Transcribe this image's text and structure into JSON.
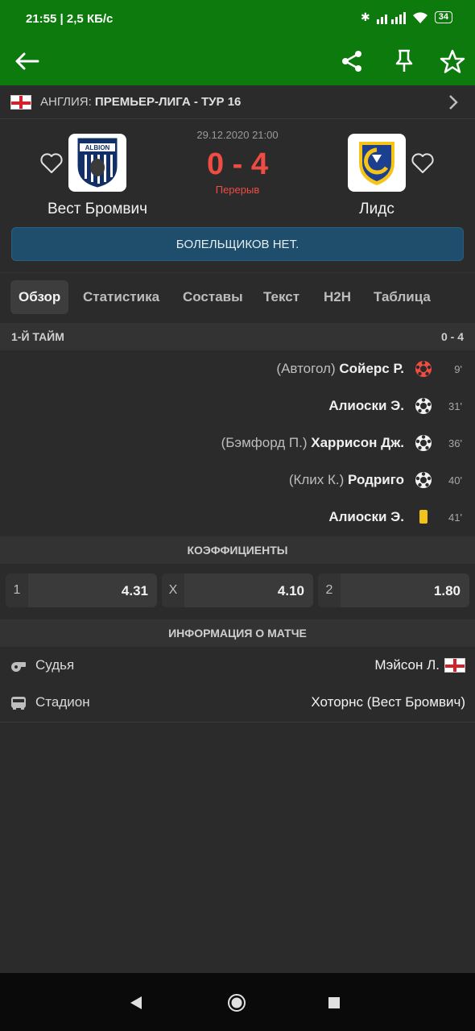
{
  "status_bar": {
    "time": "21:55",
    "speed": "2,5 КБ/с",
    "battery": "34"
  },
  "toolbar": {
    "back_icon": "arrow-left-icon",
    "share_icon": "share-icon",
    "pin_icon": "pin-icon",
    "favorite_icon": "star-icon"
  },
  "league": {
    "country": "АНГЛИЯ:",
    "name": "ПРЕМЬЕР-ЛИГА - ТУР 16"
  },
  "match": {
    "datetime": "29.12.2020 21:00",
    "score": "0 - 4",
    "status": "Перерыв",
    "home_team": "Вест Бромвич",
    "away_team": "Лидс",
    "home_logo_text": "ALBION",
    "fans_banner": "БОЛЕЛЬЩИКОВ НЕТ."
  },
  "tabs": [
    "Обзор",
    "Статистика",
    "Составы",
    "Текст",
    "H2H",
    "Таблица"
  ],
  "first_half": {
    "title": "1-Й ТАЙМ",
    "score": "0 - 4",
    "events": [
      {
        "assist": "(Автогол)",
        "player": "Сойерс Р.",
        "icon": "own-goal-icon",
        "minute": "9'"
      },
      {
        "assist": "",
        "player": "Алиоски Э.",
        "icon": "goal-icon",
        "minute": "31'"
      },
      {
        "assist": "(Бэмфорд П.)",
        "player": "Харрисон Дж.",
        "icon": "goal-icon",
        "minute": "36'"
      },
      {
        "assist": "(Клих К.)",
        "player": "Родриго",
        "icon": "goal-icon",
        "minute": "40'"
      },
      {
        "assist": "",
        "player": "Алиоски Э.",
        "icon": "yellow-card-icon",
        "minute": "41'"
      }
    ]
  },
  "odds": {
    "title": "КОЭФФИЦИЕНТЫ",
    "items": [
      {
        "key": "1",
        "value": "4.31"
      },
      {
        "key": "X",
        "value": "4.10"
      },
      {
        "key": "2",
        "value": "1.80"
      }
    ]
  },
  "match_info": {
    "title": "ИНФОРМАЦИЯ О МАТЧЕ",
    "referee_label": "Судья",
    "referee_value": "Мэйсон Л.",
    "stadium_label": "Стадион",
    "stadium_value": "Хоторнс (Вест Бромвич)"
  },
  "colors": {
    "green": "#0c7a0c",
    "score_red": "#ef4c43",
    "fans_blue": "#1e4e6b",
    "yellow_card": "#f2c21b"
  }
}
